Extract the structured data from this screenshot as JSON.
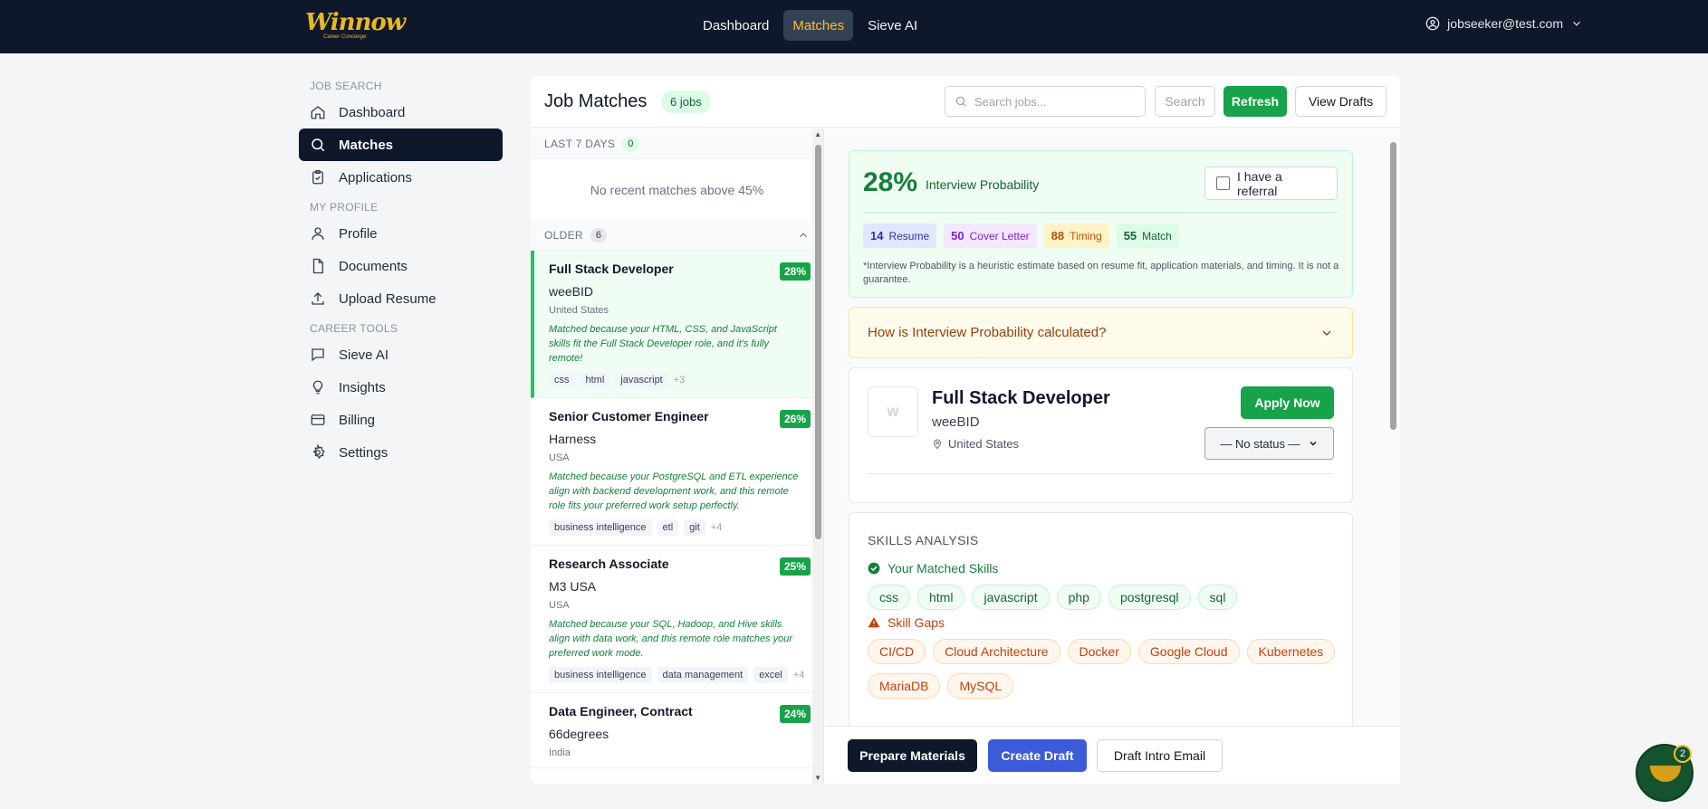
{
  "brand": {
    "logo_text": "Winnow",
    "logo_sub": "Career Concierge"
  },
  "nav": {
    "items": [
      "Dashboard",
      "Matches",
      "Sieve AI"
    ],
    "active": "Matches"
  },
  "user": {
    "email": "jobseeker@test.com"
  },
  "sidebar": {
    "sections": [
      {
        "title": "JOB SEARCH",
        "items": [
          {
            "label": "Dashboard",
            "icon": "home-icon"
          },
          {
            "label": "Matches",
            "icon": "search-icon",
            "active": true
          },
          {
            "label": "Applications",
            "icon": "clipboard-icon"
          }
        ]
      },
      {
        "title": "MY PROFILE",
        "items": [
          {
            "label": "Profile",
            "icon": "user-icon"
          },
          {
            "label": "Documents",
            "icon": "document-icon"
          },
          {
            "label": "Upload Resume",
            "icon": "upload-icon"
          }
        ]
      },
      {
        "title": "CAREER TOOLS",
        "items": [
          {
            "label": "Sieve AI",
            "icon": "chat-icon"
          },
          {
            "label": "Insights",
            "icon": "lightbulb-icon"
          },
          {
            "label": "Billing",
            "icon": "credit-card-icon"
          },
          {
            "label": "Settings",
            "icon": "gear-icon"
          }
        ]
      }
    ]
  },
  "header": {
    "title": "Job Matches",
    "jobs_count": "6 jobs",
    "search_placeholder": "Search jobs...",
    "search_label": "Search",
    "refresh_label": "Refresh",
    "drafts_label": "View Drafts"
  },
  "joblist": {
    "recent": {
      "label": "LAST 7 DAYS",
      "count": "0",
      "empty": "No recent matches above 45%"
    },
    "older": {
      "label": "OLDER",
      "count": "6"
    },
    "jobs": [
      {
        "title": "Full Stack Developer",
        "pct": "28%",
        "company": "weeBID",
        "location": "United States",
        "reason": "Matched because your HTML, CSS, and JavaScript skills fit the Full Stack Developer role, and it's fully remote!",
        "tags": [
          "css",
          "html",
          "javascript"
        ],
        "more": "+3"
      },
      {
        "title": "Senior Customer Engineer",
        "pct": "26%",
        "company": "Harness",
        "location": "USA",
        "reason": "Matched because your PostgreSQL and ETL experience align with backend development work, and this remote role fits your preferred work setup perfectly.",
        "tags": [
          "business intelligence",
          "etl",
          "git"
        ],
        "more": "+4"
      },
      {
        "title": "Research Associate",
        "pct": "25%",
        "company": "M3 USA",
        "location": "USA",
        "reason": "Matched because your SQL, Hadoop, and Hive skills align with data work, and this remote role matches your preferred work mode.",
        "tags": [
          "business intelligence",
          "data management",
          "excel"
        ],
        "more": "+4"
      },
      {
        "title": "Data Engineer, Contract",
        "pct": "24%",
        "company": "66degrees",
        "location": "India"
      }
    ]
  },
  "detail": {
    "probability": "28%",
    "probability_label": "Interview Probability",
    "referral_label": "I have a referral",
    "scores": [
      {
        "value": "14",
        "label": "Resume"
      },
      {
        "value": "50",
        "label": "Cover Letter"
      },
      {
        "value": "88",
        "label": "Timing"
      },
      {
        "value": "55",
        "label": "Match"
      }
    ],
    "note": "*Interview Probability is a heuristic estimate based on resume fit, application materials, and timing. It is not a guarantee.",
    "calc_question": "How is Interview Probability calculated?",
    "job": {
      "logo_letter": "W",
      "title": "Full Stack Developer",
      "company": "weeBID",
      "location": "United States",
      "apply_label": "Apply Now",
      "status": "— No status —"
    },
    "skills": {
      "heading": "SKILLS ANALYSIS",
      "matched_label": "Your Matched Skills",
      "matched": [
        "css",
        "html",
        "javascript",
        "php",
        "postgresql",
        "sql"
      ],
      "gaps_label": "Skill Gaps",
      "gaps": [
        "CI/CD",
        "Cloud Architecture",
        "Docker",
        "Google Cloud",
        "Kubernetes",
        "MariaDB",
        "MySQL"
      ]
    },
    "actions": {
      "prepare": "Prepare Materials",
      "draft": "Create Draft",
      "intro": "Draft Intro Email"
    }
  },
  "fab": {
    "badge": "2"
  },
  "colors": {
    "nav_bg": "#0f172a",
    "accent_gold": "#fbbf24",
    "brand_green": "#16a34a",
    "draft_blue": "#3b5bdb"
  }
}
